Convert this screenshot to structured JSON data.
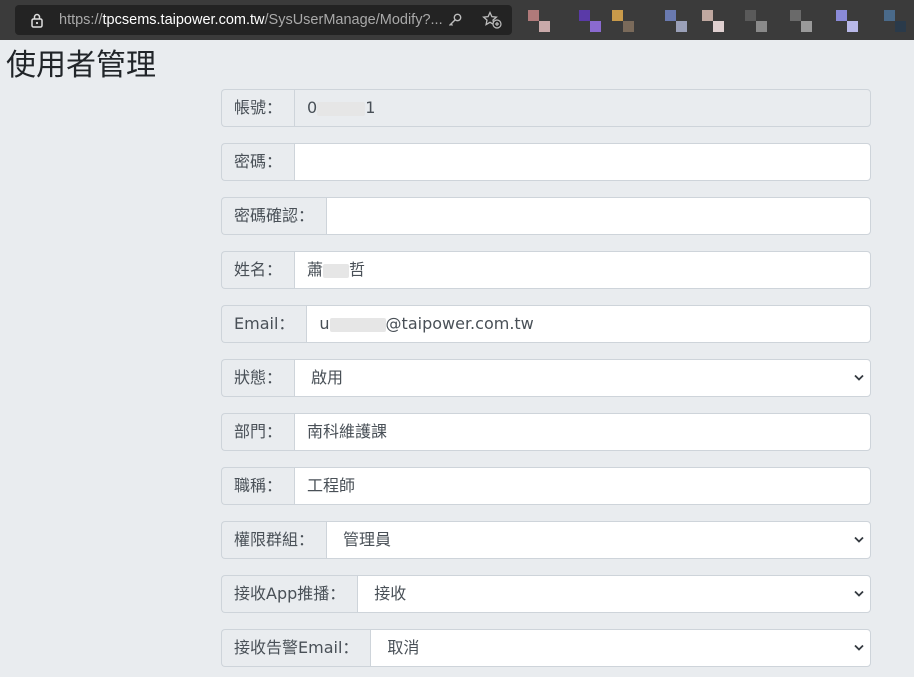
{
  "browser": {
    "url_scheme": "https://",
    "url_host": "tpcsems.taipower.com.tw",
    "url_path": "/SysUserManage/Modify?...",
    "extension_colors": [
      [
        "#b07a7a",
        "#c9a9a9"
      ],
      [
        "#5a3aa8",
        "#8a6ad0"
      ],
      [
        "#c99a4a",
        "#7a6a5a"
      ],
      [
        "#6a7ab0",
        "#9aa0b8"
      ],
      [
        "#c0a8a0",
        "#e0d0d0"
      ],
      [
        "#5a5a5a",
        "#8a8a8a"
      ],
      [
        "#6a6a6a",
        "#9a9a9a"
      ],
      [
        "#8a8ad8",
        "#b8b8e8"
      ],
      [
        "#4a6a8a",
        "#2a3a4a"
      ]
    ]
  },
  "page": {
    "title": "使用者管理"
  },
  "form": {
    "account": {
      "label": "帳號：",
      "value_start": "0",
      "value_end": "1"
    },
    "password": {
      "label": "密碼：",
      "value": ""
    },
    "password_confirm": {
      "label": "密碼確認：",
      "value": ""
    },
    "name": {
      "label": "姓名：",
      "value_start": "蕭",
      "value_end": "哲"
    },
    "email": {
      "label": "Email：",
      "value_start": "u",
      "value_end": "@taipower.com.tw"
    },
    "status": {
      "label": "狀態：",
      "selected": "啟用"
    },
    "department": {
      "label": "部門：",
      "value": "南科維護課"
    },
    "job_title": {
      "label": "職稱：",
      "value": "工程師"
    },
    "permission_group": {
      "label": "權限群組：",
      "selected": "管理員"
    },
    "app_push": {
      "label": "接收App推播：",
      "selected": "接收"
    },
    "alert_email": {
      "label": "接收告警Email：",
      "selected": "取消"
    }
  }
}
